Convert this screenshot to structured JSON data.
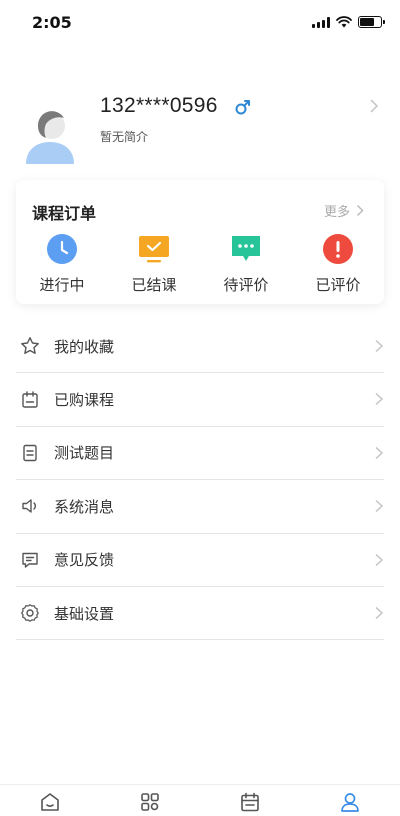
{
  "status_bar": {
    "time": "2:05"
  },
  "profile": {
    "phone": "132****0596",
    "bio": "暂无简介",
    "gender_icon": "male-icon",
    "gender_color": "#2f88d6"
  },
  "orders": {
    "title": "课程订单",
    "more": "更多",
    "items": [
      {
        "label": "进行中",
        "icon": "clock-icon",
        "color": "#5b9ef2"
      },
      {
        "label": "已结课",
        "icon": "check-screen-icon",
        "color": "#f5a623"
      },
      {
        "label": "待评价",
        "icon": "chat-bubble-icon",
        "color": "#27c49a"
      },
      {
        "label": "已评价",
        "icon": "exclamation-icon",
        "color": "#ee4b3e"
      }
    ]
  },
  "menu": [
    {
      "label": "我的收藏",
      "icon": "star-icon"
    },
    {
      "label": "已购课程",
      "icon": "calendar-icon"
    },
    {
      "label": "测试题目",
      "icon": "document-icon"
    },
    {
      "label": "系统消息",
      "icon": "speaker-icon"
    },
    {
      "label": "意见反馈",
      "icon": "feedback-icon"
    },
    {
      "label": "基础设置",
      "icon": "gear-icon"
    }
  ],
  "tabs": [
    {
      "icon": "home-icon"
    },
    {
      "icon": "grid-icon"
    },
    {
      "icon": "schedule-icon"
    },
    {
      "icon": "user-icon",
      "active": true
    }
  ],
  "colors": {
    "accent": "#3a8ee6"
  }
}
